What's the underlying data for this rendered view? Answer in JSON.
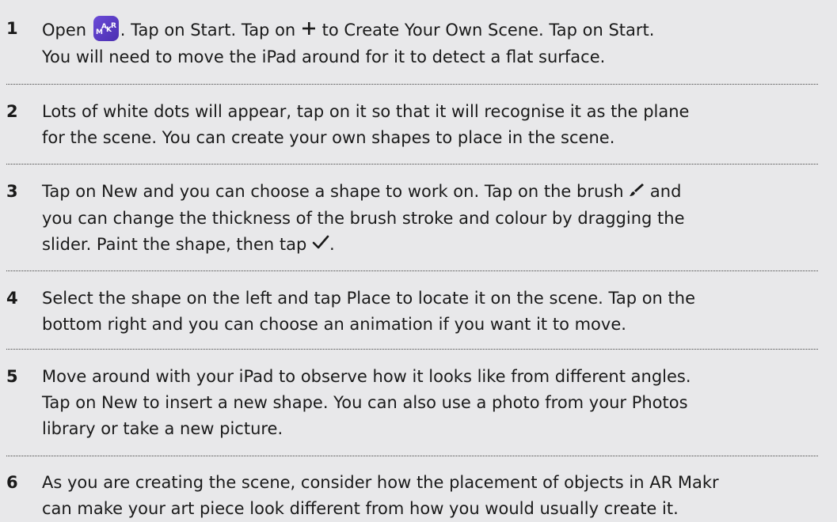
{
  "steps": [
    {
      "number": "1",
      "parts": {
        "a": "Open",
        "b": ". Tap on Start. Tap on",
        "c": "to Create Your Own Scene. Tap on Start.",
        "line2": "You will need to move the iPad around for it to detect a flat surface."
      }
    },
    {
      "number": "2",
      "lines": [
        "Lots of white dots will appear, tap on it so that it will recognise it as the plane",
        "for the scene. You can create your own shapes to place in the scene."
      ]
    },
    {
      "number": "3",
      "parts": {
        "a": "Tap on New and you can choose a shape to work on. Tap on the brush",
        "b": "and",
        "line2": "you can change the thickness of the brush stroke and colour by dragging the",
        "line3a": "slider. Paint the shape, then tap",
        "line3b": "."
      }
    },
    {
      "number": "4",
      "lines": [
        "Select the shape on the left and tap Place to locate it on the scene. Tap on the",
        "bottom right and you can choose an animation if you want it to move."
      ]
    },
    {
      "number": "5",
      "lines": [
        "Move around with your iPad to observe how it looks like from different angles.",
        "Tap on New to insert a new shape. You can also use a photo from your Photos",
        "library or take a new picture."
      ]
    },
    {
      "number": "6",
      "lines": [
        "As you are creating the scene, consider how the placement of objects in AR Makr",
        "can make your art piece look different from how you would usually create it."
      ]
    }
  ],
  "icons": {
    "app": "ar-makr-app-icon",
    "plus": "plus-icon",
    "brush": "brush-icon",
    "check": "checkmark-icon"
  },
  "app_icon_text": "MAKR",
  "colors": {
    "background": "#e8e8ea",
    "app_icon": "#5a3cc6",
    "text": "#1a1a1a"
  }
}
